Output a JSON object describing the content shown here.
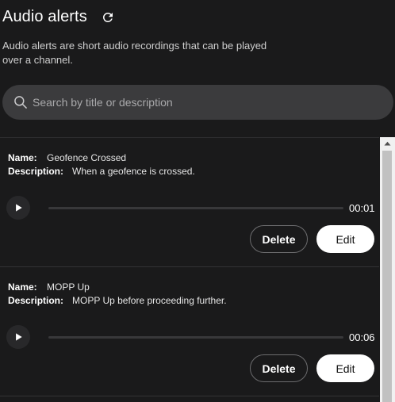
{
  "header": {
    "title": "Audio alerts"
  },
  "subtitle": "Audio alerts are short audio recordings that can be played over a channel.",
  "search": {
    "placeholder": "Search by title or description",
    "value": ""
  },
  "labels": {
    "name": "Name:",
    "description": "Description:",
    "delete": "Delete",
    "edit": "Edit"
  },
  "alerts": [
    {
      "name": "Geofence Crossed",
      "description": "When a geofence is crossed.",
      "duration": "00:01",
      "progress": 0
    },
    {
      "name": "MOPP Up",
      "description": "MOPP Up before proceeding further.",
      "duration": "00:06",
      "progress": 0
    }
  ],
  "icons": {
    "refresh": "refresh-icon",
    "search": "search-icon",
    "play": "play-icon",
    "scroll_up": "scroll-up-arrow-icon"
  }
}
